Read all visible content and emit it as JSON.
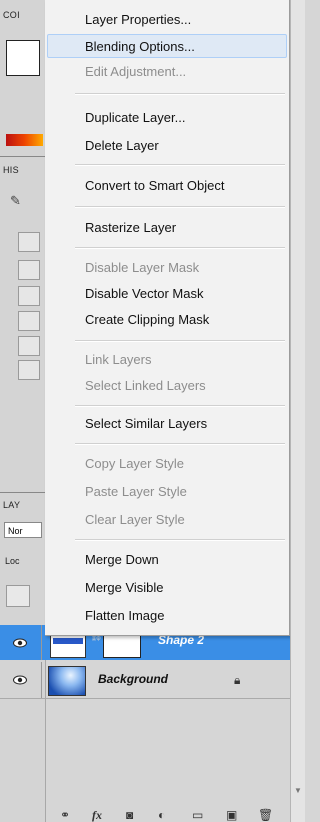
{
  "left_panel": {
    "color_tab": "COI",
    "history_tab": "HIS",
    "layers_tab": "LAY",
    "blend_mode": "Nor",
    "lock_label": "Loc"
  },
  "menu": {
    "items": [
      {
        "label": "Layer Properties..."
      },
      {
        "label": "Blending Options..."
      },
      {
        "label": "Edit Adjustment..."
      },
      {
        "label": "Duplicate Layer..."
      },
      {
        "label": "Delete Layer"
      },
      {
        "label": "Convert to Smart Object"
      },
      {
        "label": "Rasterize Layer"
      },
      {
        "label": "Disable Layer Mask"
      },
      {
        "label": "Disable Vector Mask"
      },
      {
        "label": "Create Clipping Mask"
      },
      {
        "label": "Link Layers"
      },
      {
        "label": "Select Linked Layers"
      },
      {
        "label": "Select Similar Layers"
      },
      {
        "label": "Copy Layer Style"
      },
      {
        "label": "Paste Layer Style"
      },
      {
        "label": "Clear Layer Style"
      },
      {
        "label": "Merge Down"
      },
      {
        "label": "Merge Visible"
      },
      {
        "label": "Flatten Image"
      }
    ]
  },
  "layers": [
    {
      "name": "Shape 2",
      "selected": true
    },
    {
      "name": "Background",
      "locked": true
    }
  ],
  "bottom_icons": [
    "link-icon",
    "fx-icon",
    "mask-icon",
    "adjustment-icon",
    "folder-icon",
    "new-layer-icon",
    "trash-icon"
  ]
}
